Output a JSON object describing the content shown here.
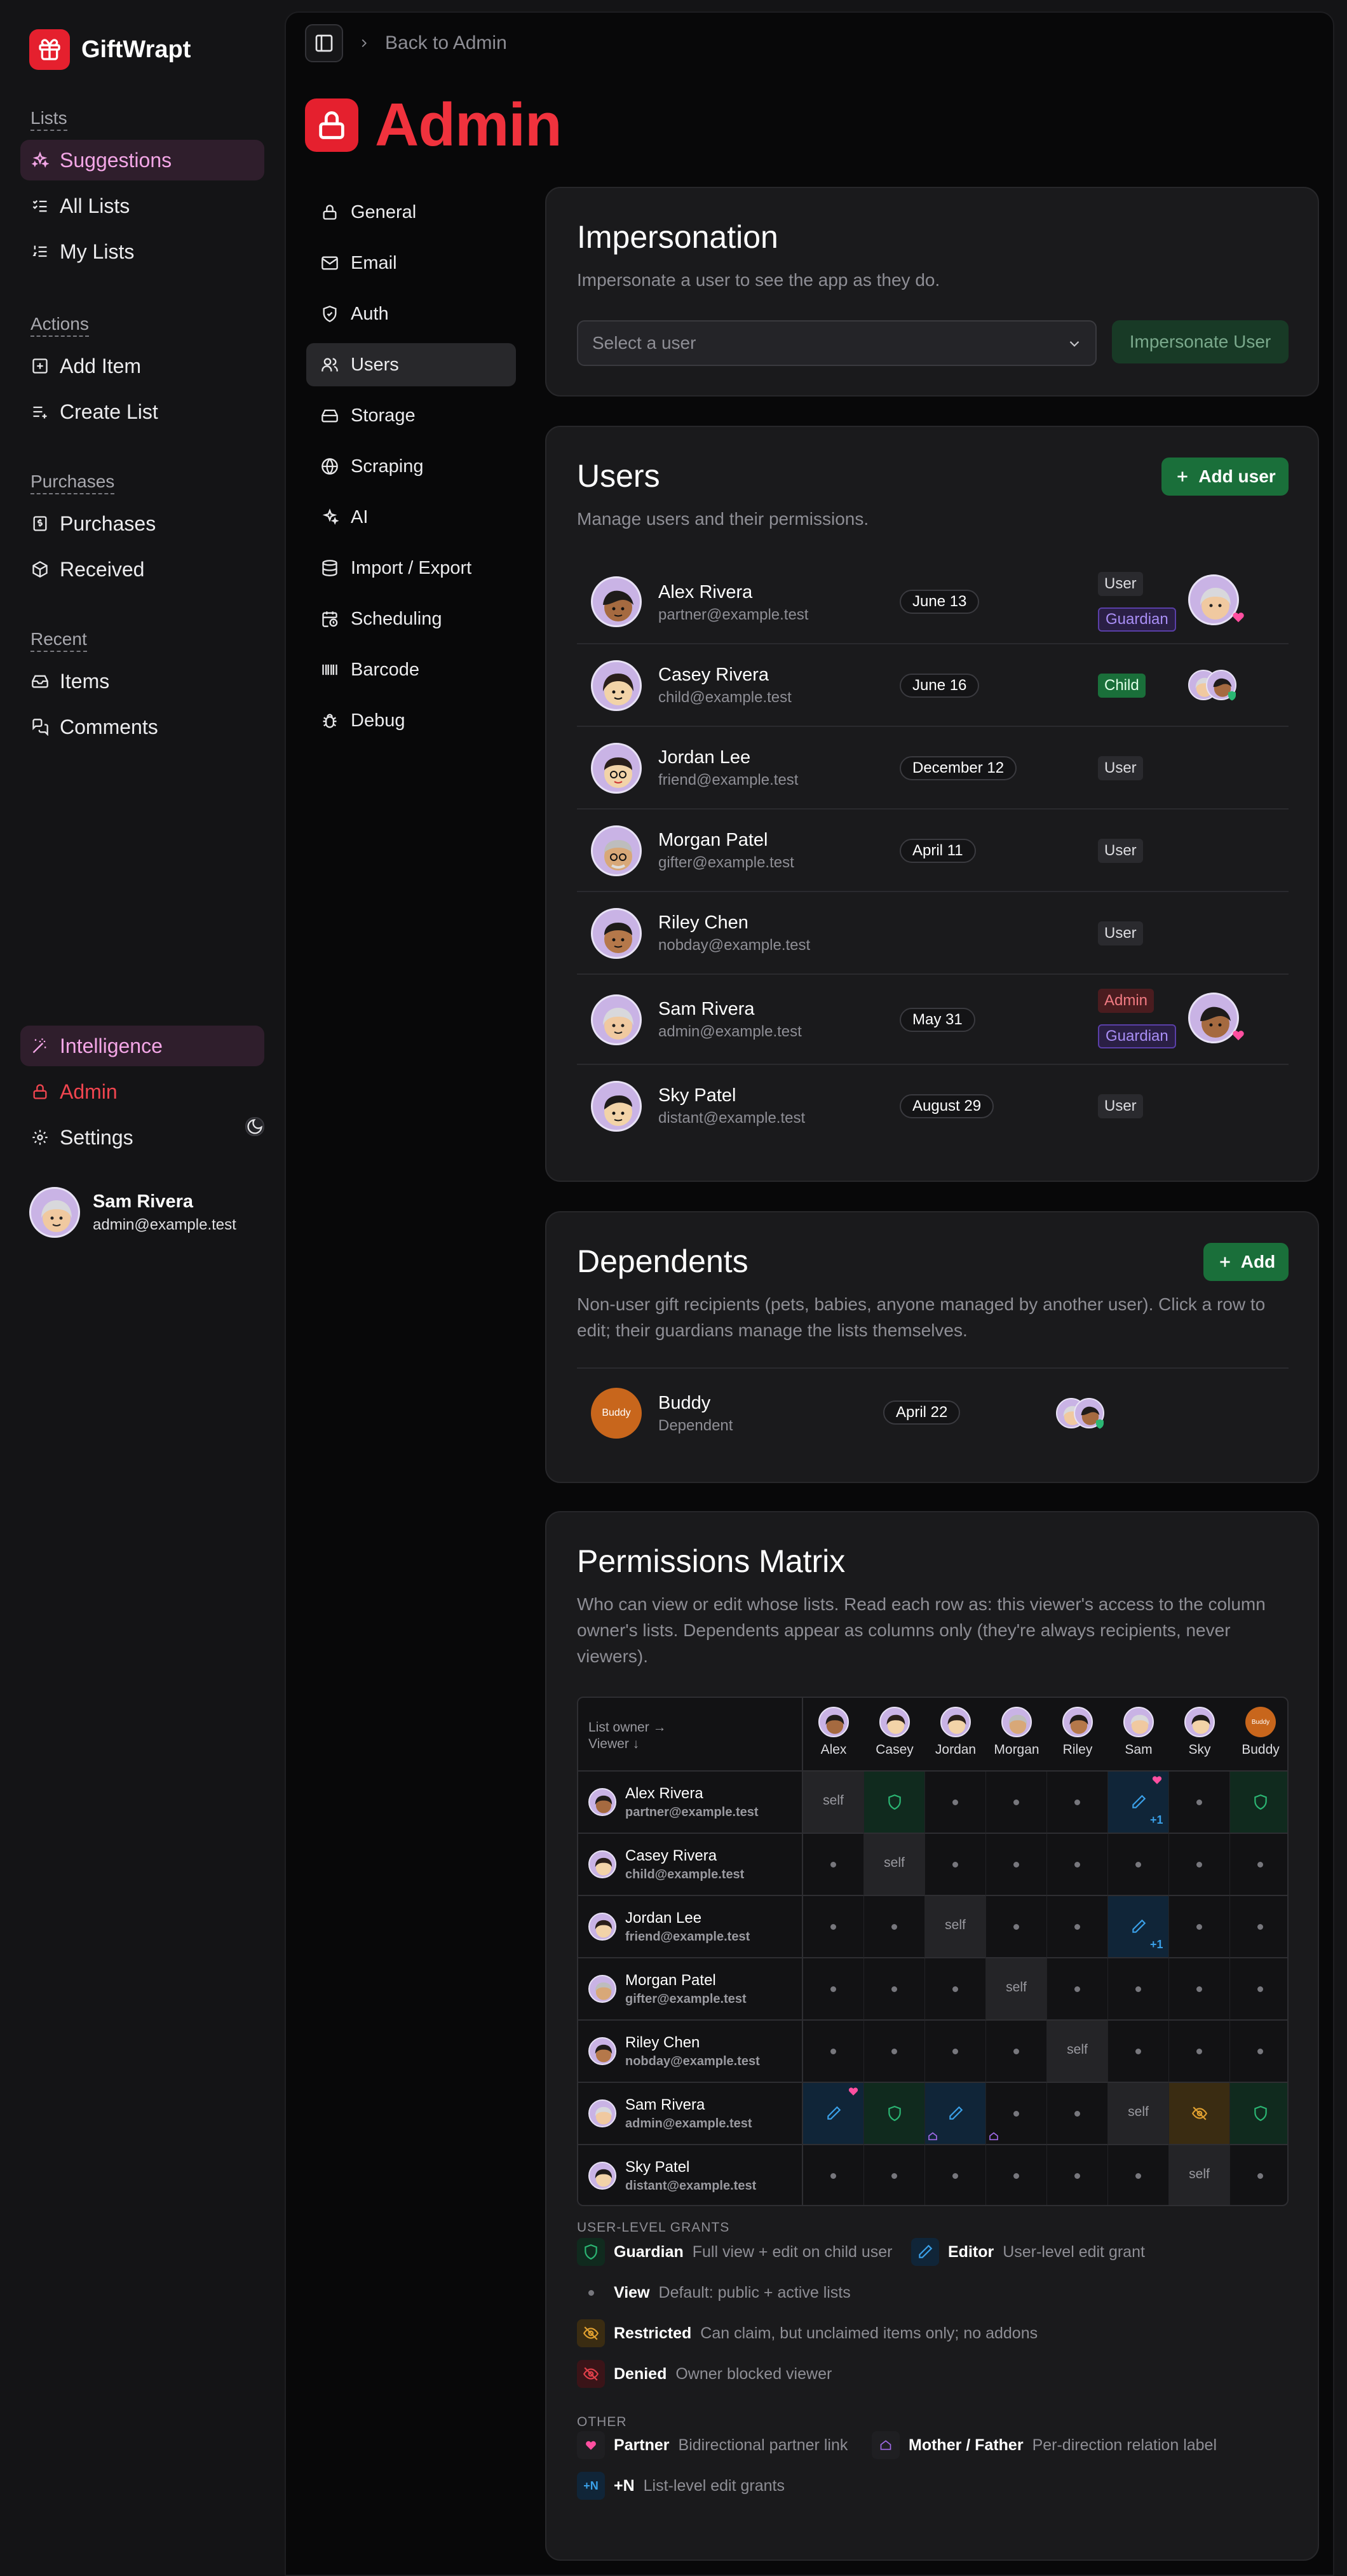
{
  "app": {
    "name": "GiftWrapt"
  },
  "sidebar": {
    "sections": [
      {
        "heading": "Lists",
        "items": [
          {
            "label": "Suggestions",
            "icon": "sparkles-icon",
            "active": true
          },
          {
            "label": "All Lists",
            "icon": "list-checks-icon"
          },
          {
            "label": "My Lists",
            "icon": "list-ordered-icon"
          }
        ]
      },
      {
        "heading": "Actions",
        "items": [
          {
            "label": "Add Item",
            "icon": "plus-square-icon"
          },
          {
            "label": "Create List",
            "icon": "list-plus-icon"
          }
        ]
      },
      {
        "heading": "Purchases",
        "items": [
          {
            "label": "Purchases",
            "icon": "receipt-icon"
          },
          {
            "label": "Received",
            "icon": "package-icon"
          }
        ]
      },
      {
        "heading": "Recent",
        "items": [
          {
            "label": "Items",
            "icon": "inbox-icon"
          },
          {
            "label": "Comments",
            "icon": "messages-icon"
          }
        ]
      }
    ],
    "bottom": {
      "intelligence": "Intelligence",
      "admin": "Admin",
      "settings": "Settings"
    },
    "user": {
      "name": "Sam Rivera",
      "email": "admin@example.test"
    }
  },
  "topbar": {
    "breadcrumb": "Back to Admin"
  },
  "page": {
    "title": "Admin"
  },
  "settings_nav": [
    {
      "label": "General",
      "icon": "lock-icon"
    },
    {
      "label": "Email",
      "icon": "mail-icon"
    },
    {
      "label": "Auth",
      "icon": "shield-icon"
    },
    {
      "label": "Users",
      "icon": "users-icon",
      "active": true
    },
    {
      "label": "Storage",
      "icon": "hard-drive-icon"
    },
    {
      "label": "Scraping",
      "icon": "globe-icon"
    },
    {
      "label": "AI",
      "icon": "sparkles-icon"
    },
    {
      "label": "Import / Export",
      "icon": "database-icon"
    },
    {
      "label": "Scheduling",
      "icon": "calendar-clock-icon"
    },
    {
      "label": "Barcode",
      "icon": "barcode-icon"
    },
    {
      "label": "Debug",
      "icon": "bug-icon"
    }
  ],
  "impersonation": {
    "title": "Impersonation",
    "description": "Impersonate a user to see the app as they do.",
    "select_placeholder": "Select a user",
    "button": "Impersonate User"
  },
  "users": {
    "title": "Users",
    "description": "Manage users and their permissions.",
    "add_button": "Add user",
    "rows": [
      {
        "name": "Alex Rivera",
        "email": "partner@example.test",
        "date": "June 13",
        "tags": [
          "User",
          "Guardian"
        ]
      },
      {
        "name": "Casey Rivera",
        "email": "child@example.test",
        "date": "June 16",
        "tags": [
          "Child"
        ]
      },
      {
        "name": "Jordan Lee",
        "email": "friend@example.test",
        "date": "December 12",
        "tags": [
          "User"
        ]
      },
      {
        "name": "Morgan Patel",
        "email": "gifter@example.test",
        "date": "April 11",
        "tags": [
          "User"
        ]
      },
      {
        "name": "Riley Chen",
        "email": "nobday@example.test",
        "date": "",
        "tags": [
          "User"
        ]
      },
      {
        "name": "Sam Rivera",
        "email": "admin@example.test",
        "date": "May 31",
        "tags": [
          "Admin",
          "Guardian"
        ]
      },
      {
        "name": "Sky Patel",
        "email": "distant@example.test",
        "date": "August 29",
        "tags": [
          "User"
        ]
      }
    ]
  },
  "dependents": {
    "title": "Dependents",
    "description": "Non-user gift recipients (pets, babies, anyone managed by another user). Click a row to edit; their guardians manage the lists themselves.",
    "add_button": "Add",
    "rows": [
      {
        "name": "Buddy",
        "subtitle": "Dependent",
        "date": "April 22",
        "avatar_text": "Buddy"
      }
    ]
  },
  "matrix": {
    "title": "Permissions Matrix",
    "description": "Who can view or edit whose lists. Read each row as: this viewer's access to the column owner's lists. Dependents appear as columns only (they're always recipients, never viewers).",
    "corner_top": "List owner →",
    "corner_bottom": "Viewer ↓",
    "columns": [
      "Alex",
      "Casey",
      "Jordan",
      "Morgan",
      "Riley",
      "Sam",
      "Sky",
      "Buddy"
    ],
    "self_label": "self",
    "plus_label": "+1",
    "rows": [
      {
        "name": "Alex Rivera",
        "email": "partner@example.test",
        "cells": [
          "self",
          "guardian",
          "view",
          "view",
          "view",
          "edit",
          "view",
          "guardian"
        ]
      },
      {
        "name": "Casey Rivera",
        "email": "child@example.test",
        "cells": [
          "view",
          "self",
          "view",
          "view",
          "view",
          "view",
          "view",
          "view"
        ]
      },
      {
        "name": "Jordan Lee",
        "email": "friend@example.test",
        "cells": [
          "view",
          "view",
          "self",
          "view",
          "view",
          "edit",
          "view",
          "view"
        ]
      },
      {
        "name": "Morgan Patel",
        "email": "gifter@example.test",
        "cells": [
          "view",
          "view",
          "view",
          "self",
          "view",
          "view",
          "view",
          "view"
        ]
      },
      {
        "name": "Riley Chen",
        "email": "nobday@example.test",
        "cells": [
          "view",
          "view",
          "view",
          "view",
          "self",
          "view",
          "view",
          "view"
        ]
      },
      {
        "name": "Sam Rivera",
        "email": "admin@example.test",
        "cells": [
          "edit",
          "guardian",
          "edit",
          "view",
          "view",
          "self",
          "restricted",
          "guardian"
        ]
      },
      {
        "name": "Sky Patel",
        "email": "distant@example.test",
        "cells": [
          "view",
          "view",
          "view",
          "view",
          "view",
          "view",
          "self",
          "view"
        ]
      }
    ]
  },
  "legend": {
    "user_heading": "USER-LEVEL GRANTS",
    "other_heading": "OTHER",
    "guardian": {
      "label": "Guardian",
      "desc": "Full view + edit on child user"
    },
    "editor": {
      "label": "Editor",
      "desc": "User-level edit grant"
    },
    "view": {
      "label": "View",
      "desc": "Default: public + active lists"
    },
    "restricted": {
      "label": "Restricted",
      "desc": "Can claim, but unclaimed items only; no addons"
    },
    "denied": {
      "label": "Denied",
      "desc": "Owner blocked viewer"
    },
    "partner": {
      "label": "Partner",
      "desc": "Bidirectional partner link"
    },
    "parent": {
      "label": "Mother / Father",
      "desc": "Per-direction relation label"
    },
    "plusn": {
      "badge": "+N",
      "label": "+N",
      "desc": "List-level edit grants"
    }
  },
  "colors": {
    "accent": "#e5202e",
    "suggestion": "#f3a6e6",
    "green": "#1a6f3a",
    "guardian": "#2bb673",
    "editor": "#3aa0e8",
    "restricted": "#e0a030",
    "denied": "#e0404a",
    "partner": "#ff4fa0"
  }
}
